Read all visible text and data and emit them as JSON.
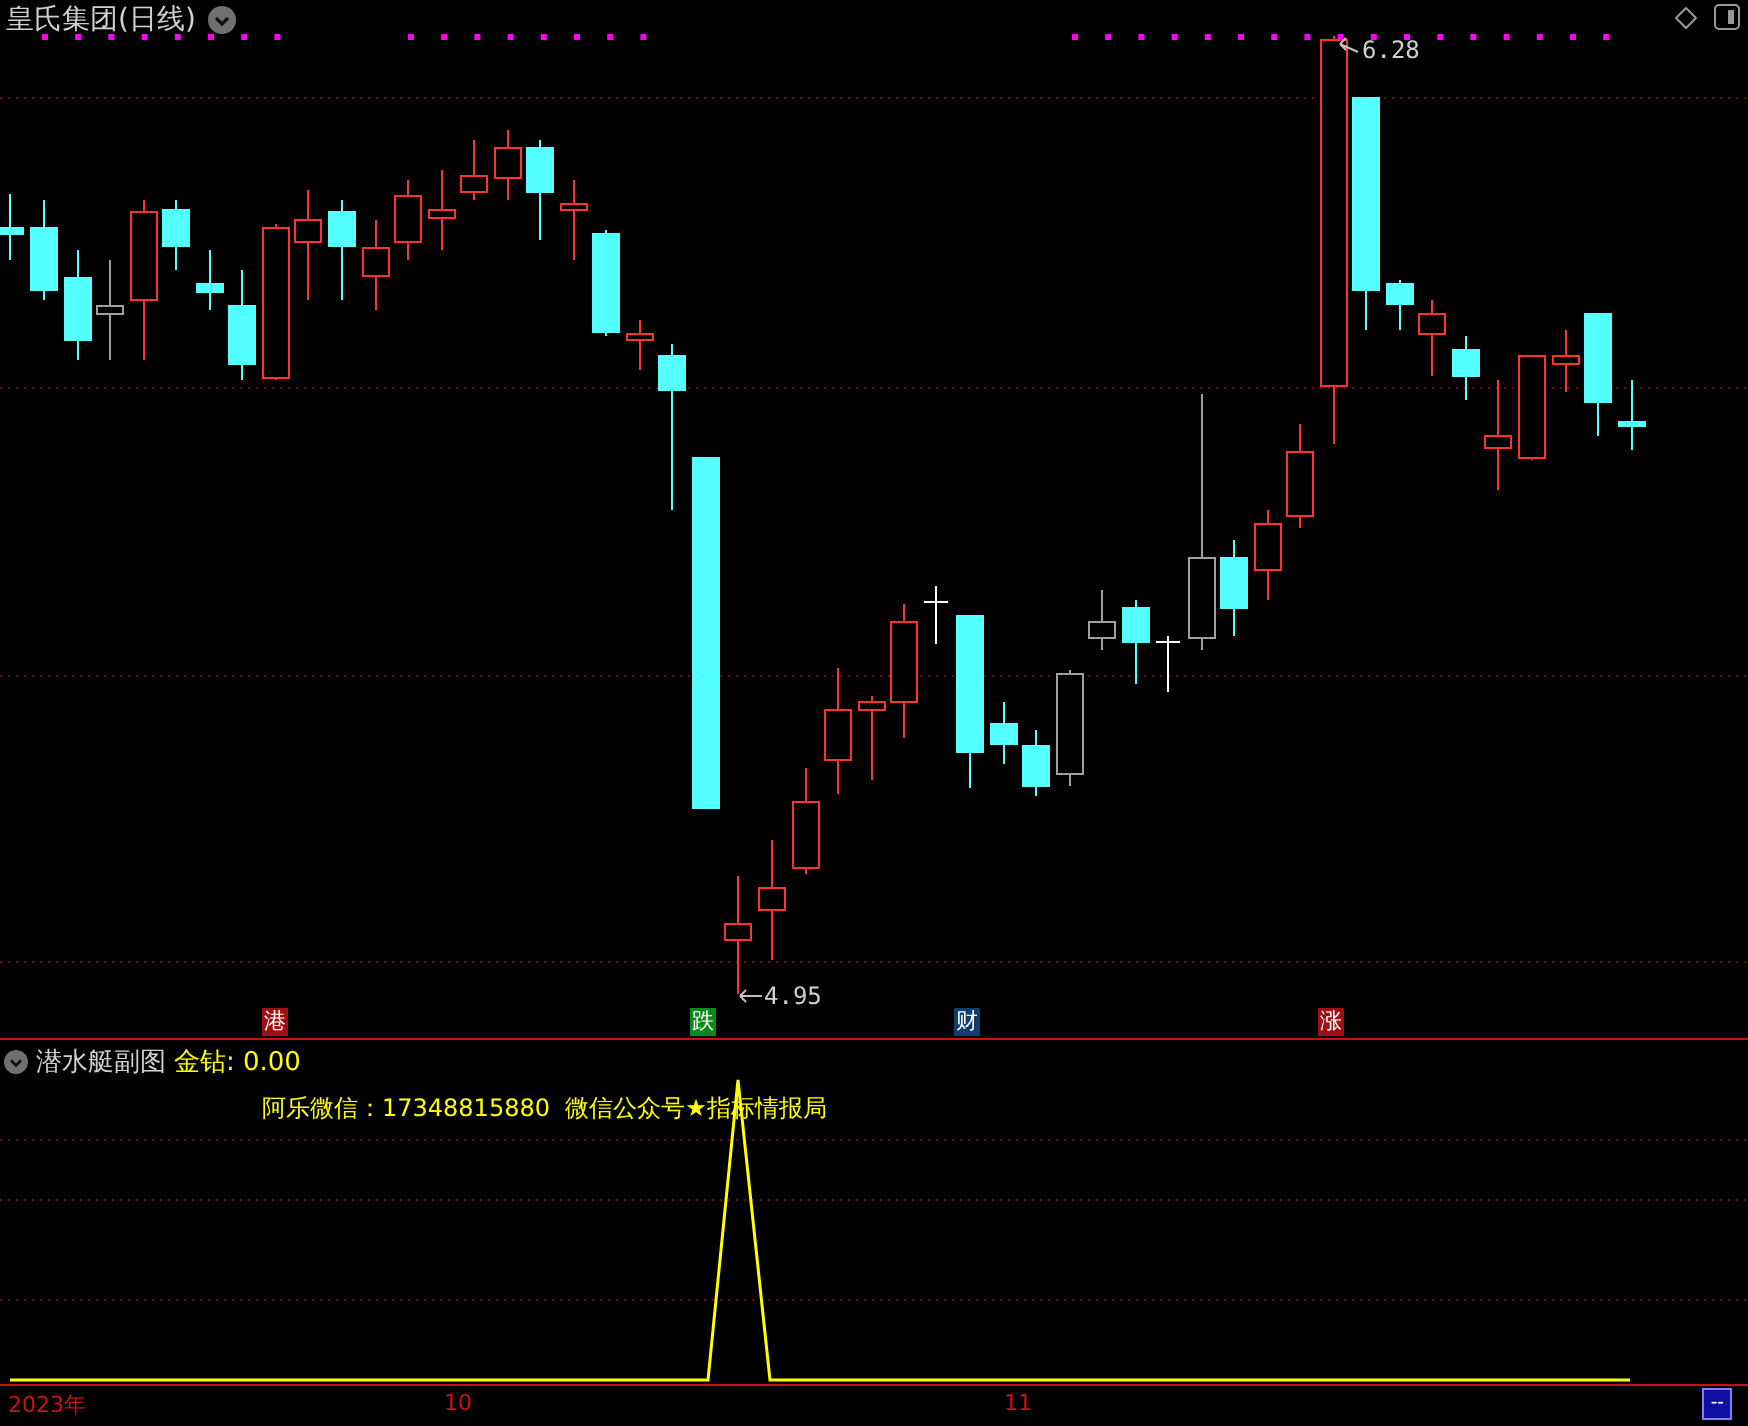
{
  "header": {
    "title": "皇氏集团(日线)"
  },
  "price_labels": [
    {
      "text": "6.28"
    },
    {
      "text": "4.95"
    }
  ],
  "events": [
    {
      "label": "港",
      "color": "#a01010"
    },
    {
      "label": "跌",
      "color": "#0a8a1a"
    },
    {
      "label": "财",
      "color": "#103c6e"
    },
    {
      "label": "涨",
      "color": "#a01010"
    }
  ],
  "sub_chart": {
    "title": "潜水艇副图",
    "indicator": "金钻: 0.00",
    "note": "阿乐微信：17348815880  微信公众号★指标情报局"
  },
  "axis": {
    "labels": [
      "2023年",
      "10",
      "11"
    ]
  },
  "corner_button": "--"
}
